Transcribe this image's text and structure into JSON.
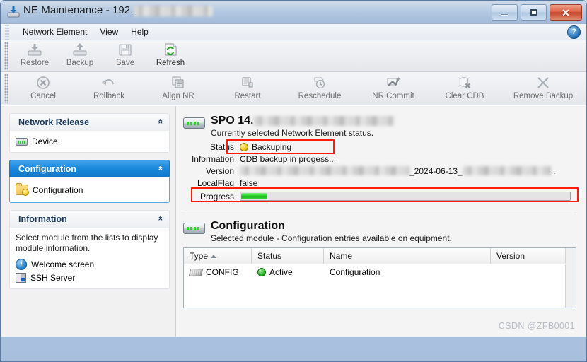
{
  "window": {
    "title_prefix": "NE Maintenance - 192.",
    "title_redacted": true,
    "icon": "restore-download-icon",
    "buttons": {
      "minimize": "minimize-button",
      "maximize": "maximize-button",
      "close": "✕"
    }
  },
  "menubar": {
    "items": [
      "Network Element",
      "View",
      "Help"
    ],
    "help_glyph": "?"
  },
  "toolbar_primary": [
    {
      "label": "Restore",
      "icon": "restore-icon",
      "enabled": false
    },
    {
      "label": "Backup",
      "icon": "backup-icon",
      "enabled": false
    },
    {
      "label": "Save",
      "icon": "save-icon",
      "enabled": false
    },
    {
      "label": "Refresh",
      "icon": "refresh-icon",
      "enabled": true
    }
  ],
  "toolbar_secondary": [
    {
      "label": "Cancel",
      "icon": "cancel-icon",
      "enabled": false
    },
    {
      "label": "Rollback",
      "icon": "rollback-icon",
      "enabled": false
    },
    {
      "label": "Align NR",
      "icon": "align-nr-icon",
      "enabled": false
    },
    {
      "label": "Restart",
      "icon": "restart-icon",
      "enabled": false
    },
    {
      "label": "Reschedule",
      "icon": "reschedule-icon",
      "enabled": false
    },
    {
      "label": "NR Commit",
      "icon": "nr-commit-icon",
      "enabled": false
    },
    {
      "label": "Clear CDB",
      "icon": "clear-cdb-icon",
      "enabled": false
    },
    {
      "label": "Remove Backup",
      "icon": "remove-backup-icon",
      "enabled": false
    }
  ],
  "sidebar": {
    "groups": [
      {
        "title": "Network Release",
        "selected": false,
        "collapse_glyph": "«",
        "items": [
          {
            "label": "Device",
            "icon": "device-icon"
          }
        ]
      },
      {
        "title": "Configuration",
        "selected": true,
        "collapse_glyph": "«",
        "items": [
          {
            "label": "Configuration",
            "icon": "config-folder-icon"
          }
        ]
      },
      {
        "title": "Information",
        "selected": false,
        "collapse_glyph": "«",
        "hint": "Select module from the lists to display module information.",
        "items": [
          {
            "label": "Welcome screen",
            "icon": "info-icon"
          },
          {
            "label": "SSH Server",
            "icon": "ssh-server-icon"
          }
        ]
      }
    ]
  },
  "status_panel": {
    "icon": "network-element-icon",
    "title": "SPO 14.",
    "title_has_redaction": true,
    "subtitle": "Currently selected Network Element status.",
    "fields": [
      {
        "key": "Status",
        "value": "Backuping",
        "indicator": "yellow",
        "highlighted": true
      },
      {
        "key": "Information",
        "value": "CDB backup in progess...",
        "indicator": "none",
        "highlighted": false
      },
      {
        "key": "Version",
        "value": "_2024-06-13_",
        "indicator": "none",
        "highlighted": false,
        "redacted": true,
        "trailing": ".."
      },
      {
        "key": "LocalFlag",
        "value": "false",
        "indicator": "none",
        "highlighted": false
      }
    ],
    "progress": {
      "key": "Progress",
      "percent": 8,
      "highlighted": true
    }
  },
  "config_panel": {
    "icon": "network-element-icon",
    "title": "Configuration",
    "subtitle": "Selected module - Configuration entries available on equipment.",
    "table": {
      "columns": [
        "Type",
        "Status",
        "Name",
        "Version"
      ],
      "sorted_column": "Type",
      "sort_direction": "asc",
      "rows": [
        {
          "type": "CONFIG",
          "type_icon": "chip-icon",
          "status": "Active",
          "status_indicator": "green",
          "name": "Configuration",
          "version": ""
        }
      ]
    }
  },
  "watermark": "CSDN @ZFB0001",
  "colors": {
    "accent_blue": "#1684d8",
    "highlight_red": "#fe1d09",
    "status_yellow": "#f2c310",
    "status_green": "#19b219",
    "progress_green": "#28cf28"
  }
}
